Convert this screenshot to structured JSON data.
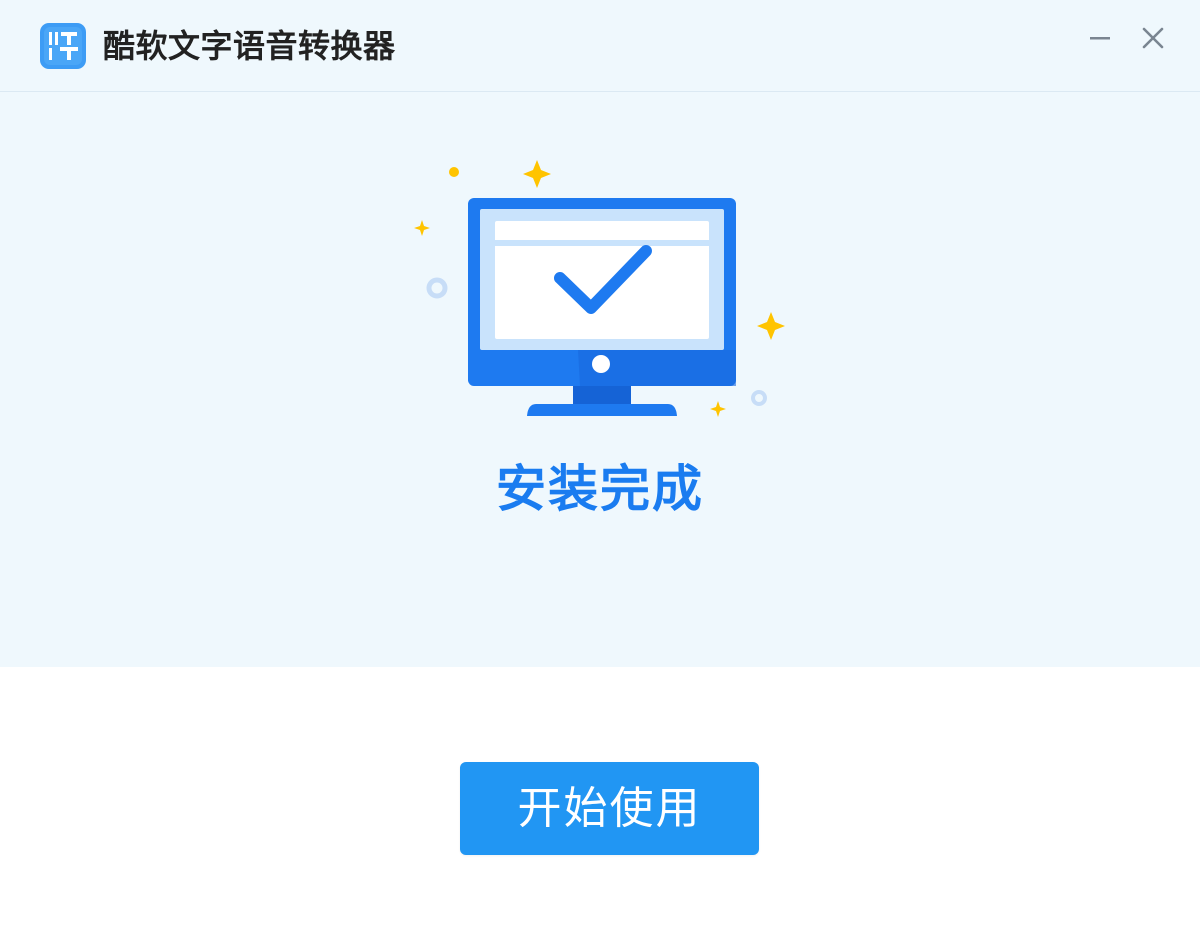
{
  "window": {
    "title": "酷软文字语音转换器",
    "app_icon": "app-logo-icon",
    "controls": {
      "minimize_icon": "minimize-icon",
      "close_icon": "close-icon"
    }
  },
  "main": {
    "illustration": "monitor-checkmark-illustration",
    "status_text": "安装完成"
  },
  "footer": {
    "start_button_label": "开始使用"
  },
  "colors": {
    "accent": "#1a7cf0",
    "button": "#2196f3",
    "background": "#eff8fd",
    "sparkle": "#ffc400"
  }
}
